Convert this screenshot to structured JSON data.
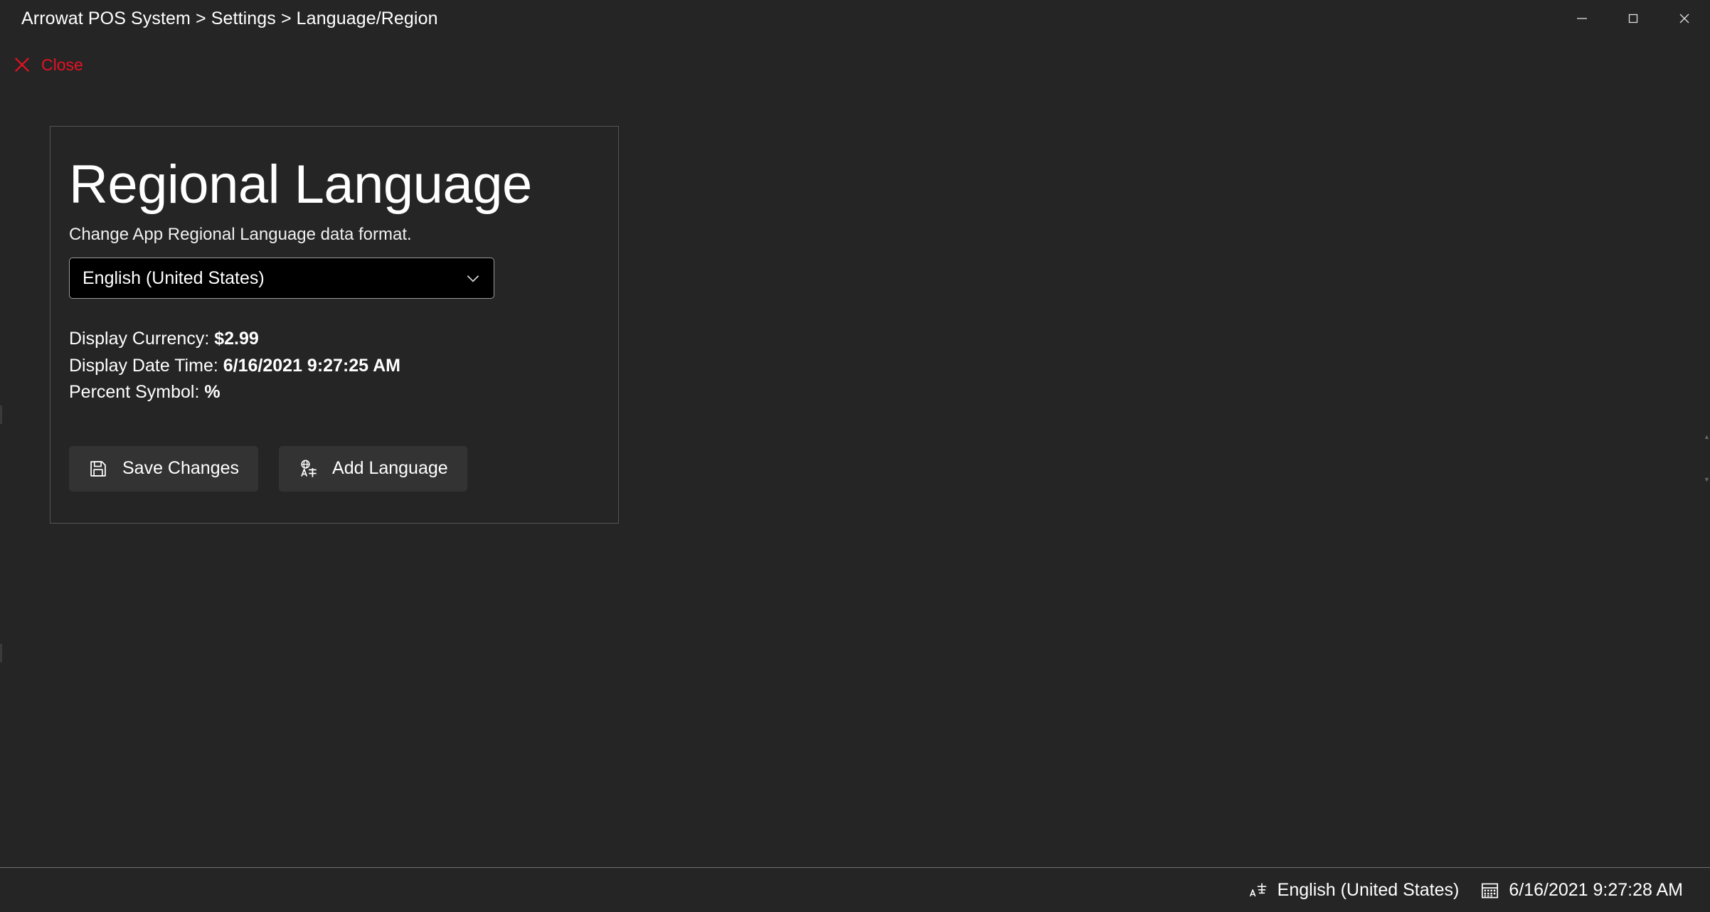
{
  "window": {
    "breadcrumb": "Arrowat POS System > Settings > Language/Region",
    "controls": {
      "minimize": "Minimize",
      "maximize": "Maximize",
      "close": "Close"
    }
  },
  "toolbar": {
    "close_label": "Close",
    "close_color": "#e81123"
  },
  "card": {
    "title": "Regional Language",
    "subtitle": "Change App Regional Language data format.",
    "combo": {
      "selected": "English (United States)"
    },
    "info": [
      {
        "label": "Display Currency: ",
        "value": "$2.99"
      },
      {
        "label": "Display Date Time: ",
        "value": "6/16/2021 9:27:25 AM"
      },
      {
        "label": "Percent Symbol: ",
        "value": "%"
      }
    ],
    "buttons": {
      "save": "Save Changes",
      "add_language": "Add Language"
    }
  },
  "statusbar": {
    "language": "English (United States)",
    "datetime": "6/16/2021 9:27:28 AM"
  }
}
